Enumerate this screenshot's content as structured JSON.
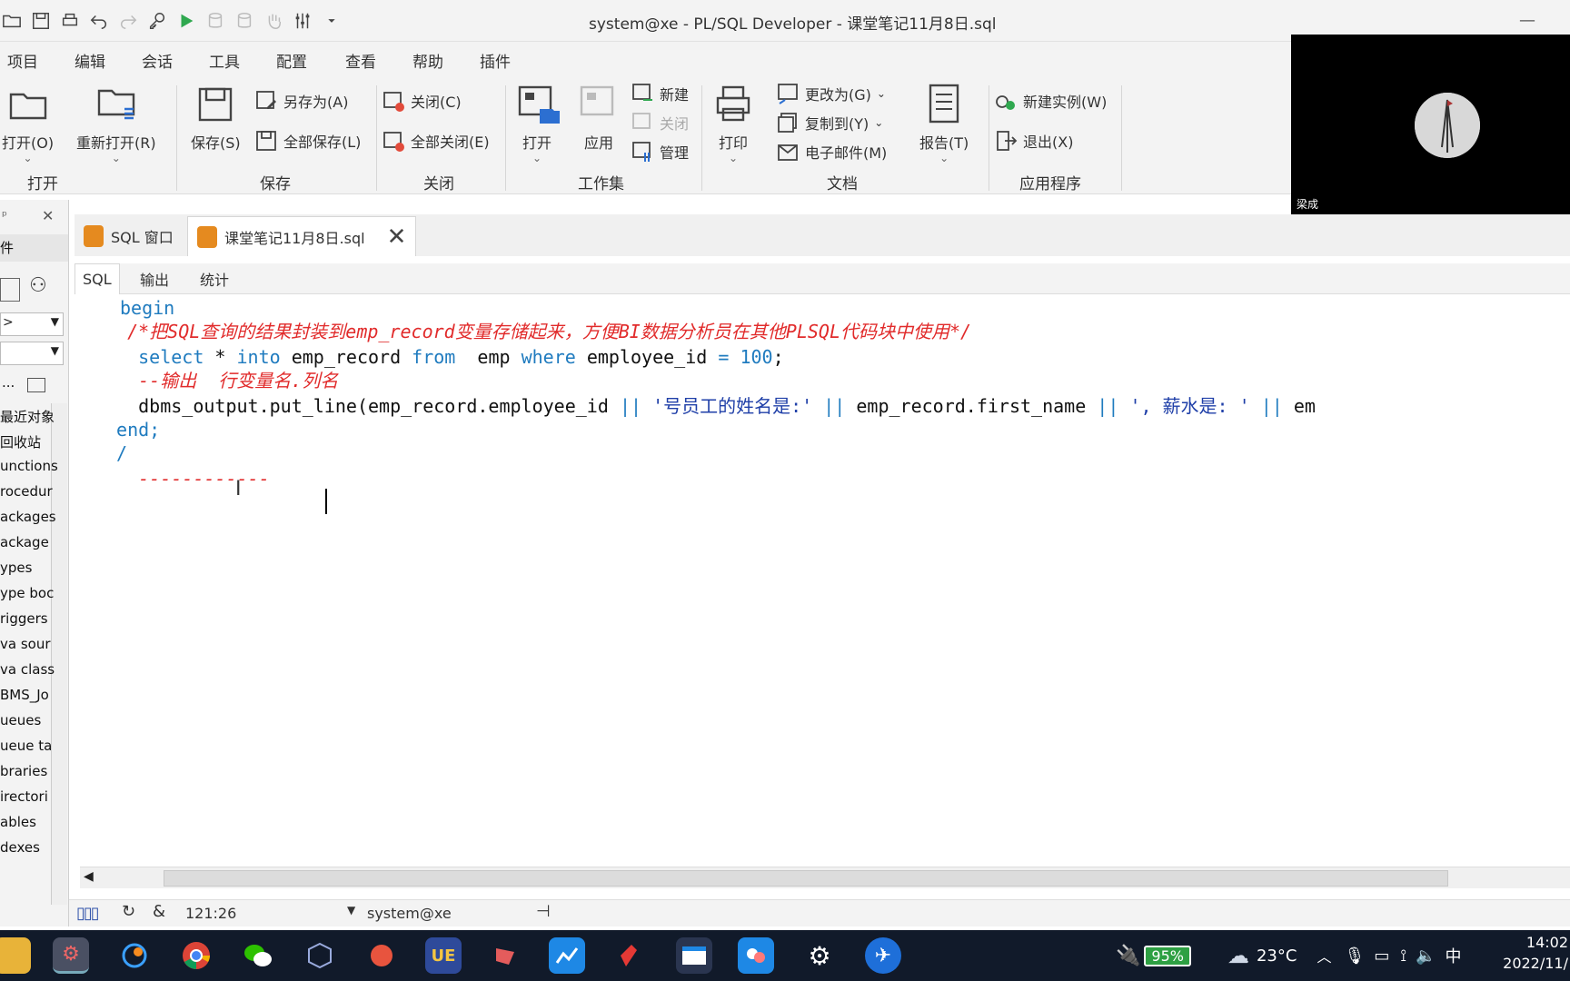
{
  "window": {
    "title": "system@xe - PL/SQL Developer - 课堂笔记11月8日.sql"
  },
  "menu": [
    "项目",
    "编辑",
    "会话",
    "工具",
    "配置",
    "查看",
    "帮助",
    "插件"
  ],
  "ribbon": {
    "open_group": {
      "label": "打开",
      "open": "打开(O)",
      "reopen": "重新打开(R)"
    },
    "save_group": {
      "label": "保存",
      "save": "保存(S)",
      "save_as": "另存为(A)",
      "save_all": "全部保存(L)"
    },
    "close_group": {
      "label": "关闭",
      "close": "关闭(C)",
      "close_all": "全部关闭(E)"
    },
    "workset_group": {
      "label": "工作集",
      "open": "打开",
      "apply": "应用",
      "new": "新建",
      "close": "关闭",
      "manage": "管理"
    },
    "doc_group": {
      "label": "文档",
      "print": "打印",
      "change_to": "更改为(G)",
      "copy_to": "复制到(Y)",
      "email": "电子邮件(M)",
      "report": "报告(T)"
    },
    "app_group": {
      "label": "应用程序",
      "new_instance": "新建实例(W)",
      "exit": "退出(X)"
    }
  },
  "video": {
    "name": "梁成"
  },
  "left_panel": {
    "header_icons": [
      "pin-icon",
      "close-icon"
    ],
    "title": "件",
    "dropdown1": ">",
    "more": "...",
    "tree_items": [
      "最近对象",
      "回收站",
      "unctions",
      "rocedur",
      "ackages",
      "ackage",
      "ypes",
      "ype boc",
      "riggers",
      "va sour",
      "va class",
      "BMS_Jo",
      "ueues",
      "ueue ta",
      "braries",
      "irectori",
      "ables",
      "dexes"
    ]
  },
  "doc_tabs": [
    {
      "label": "SQL 窗口"
    },
    {
      "label": "课堂笔记11月8日.sql"
    }
  ],
  "sub_tabs": [
    "SQL",
    "输出",
    "统计"
  ],
  "editor": {
    "lines": [
      [
        {
          "t": "begin",
          "c": "kw"
        }
      ],
      [
        {
          "t": "  /*把SQL查询的结果封装到emp_record变量存储起来，方便BI数据分析员在其他PLSQL代码块中使用*/",
          "c": "cm"
        }
      ],
      [
        {
          "t": "   select",
          "c": "kw"
        },
        {
          "t": " * ",
          "c": "txt"
        },
        {
          "t": "into",
          "c": "kw"
        },
        {
          "t": " emp_record ",
          "c": "txt"
        },
        {
          "t": "from",
          "c": "kw"
        },
        {
          "t": "  emp ",
          "c": "txt"
        },
        {
          "t": "where",
          "c": "kw"
        },
        {
          "t": " employee_id ",
          "c": "txt"
        },
        {
          "t": "=",
          "c": "kw"
        },
        {
          "t": " ",
          "c": "txt"
        },
        {
          "t": "100",
          "c": "num"
        },
        {
          "t": ";",
          "c": "txt"
        }
      ],
      [
        {
          "t": "   --输出  行变量名.列名",
          "c": "cm"
        }
      ],
      [
        {
          "t": "   dbms_output.put_line(emp_record.employee_id ",
          "c": "txt"
        },
        {
          "t": "||",
          "c": "kw"
        },
        {
          "t": " ",
          "c": "txt"
        },
        {
          "t": "'号员工的姓名是:'",
          "c": "str"
        },
        {
          "t": " ",
          "c": "txt"
        },
        {
          "t": "||",
          "c": "kw"
        },
        {
          "t": " emp_record.first_name ",
          "c": "txt"
        },
        {
          "t": "||",
          "c": "kw"
        },
        {
          "t": " ",
          "c": "txt"
        },
        {
          "t": "', 薪水是: '",
          "c": "str"
        },
        {
          "t": " ",
          "c": "txt"
        },
        {
          "t": "||",
          "c": "kw"
        },
        {
          "t": " em",
          "c": "txt"
        }
      ],
      [
        {
          "t": " end;",
          "c": "kw"
        }
      ],
      [
        {
          "t": " /",
          "c": "kw"
        }
      ],
      [
        {
          "t": "   ------------",
          "c": "cm"
        }
      ]
    ]
  },
  "status": {
    "position": "121:26",
    "connection": "system@xe"
  },
  "taskbar": {
    "battery": "95%",
    "temperature": "23°C",
    "ime": "中",
    "time": "14:02",
    "date": "2022/11/"
  }
}
